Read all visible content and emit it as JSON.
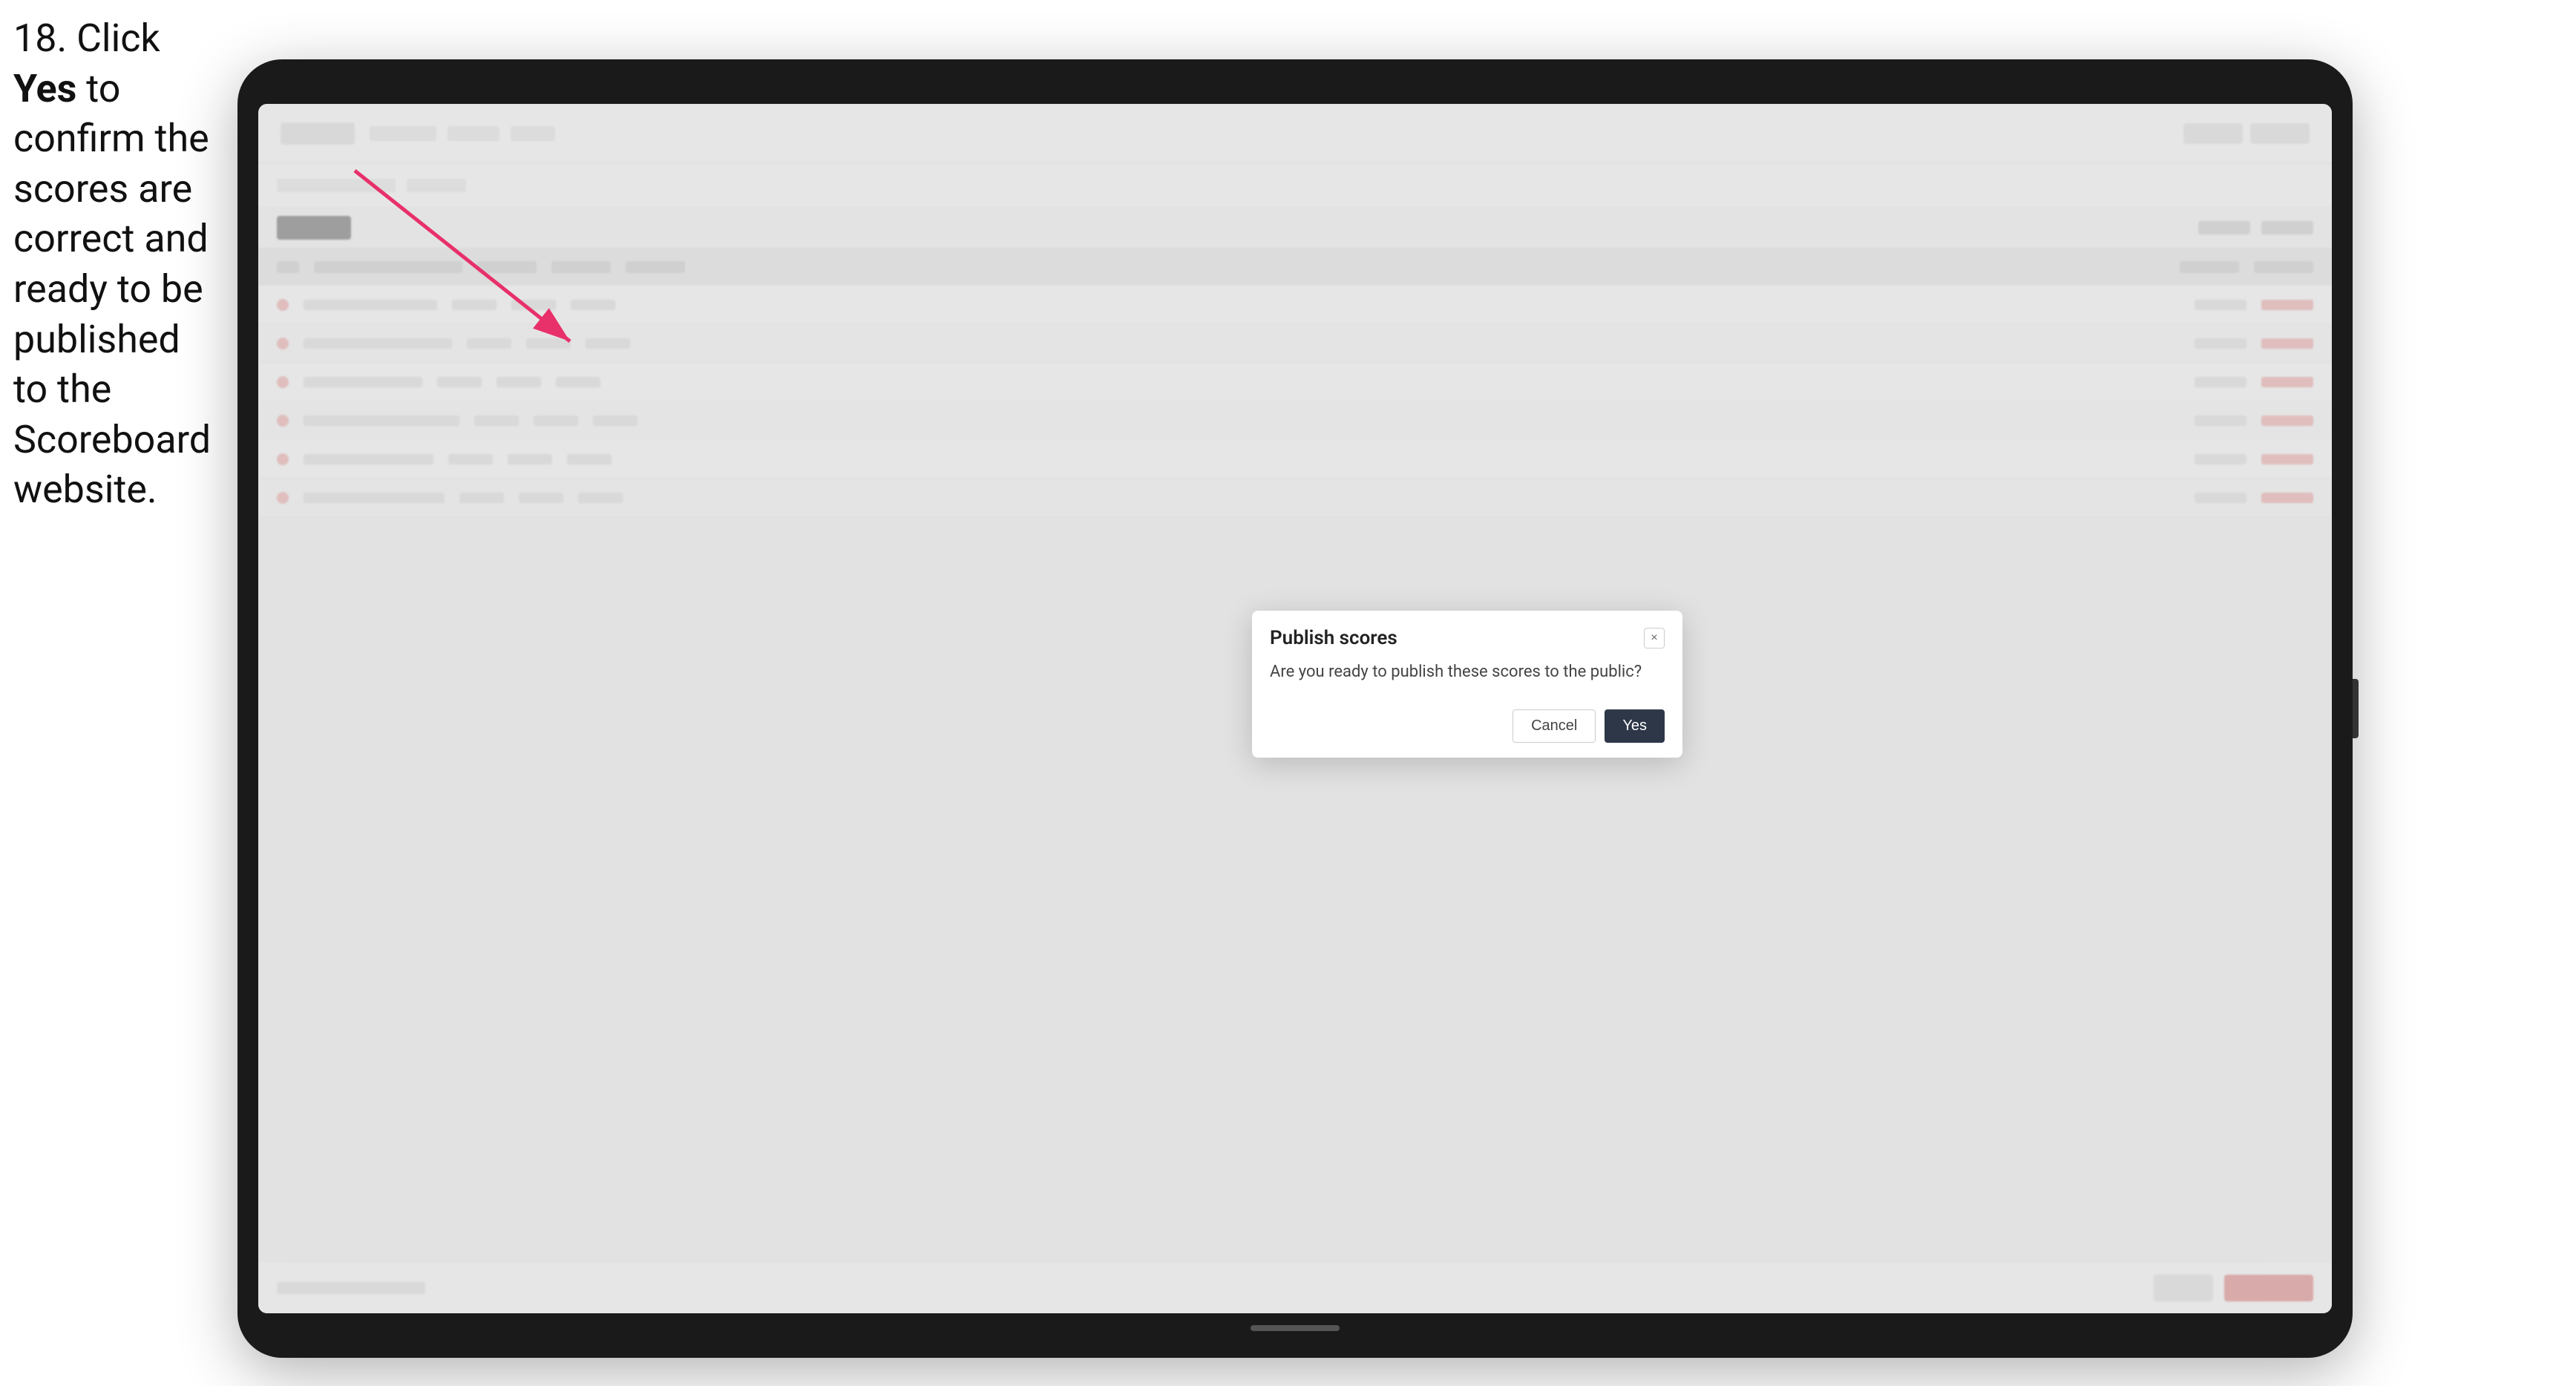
{
  "instruction": {
    "step": "18.",
    "text_before_bold": " Click ",
    "bold_text": "Yes",
    "text_after": " to confirm the scores are correct and ready to be published to the Scoreboard website."
  },
  "dialog": {
    "title": "Publish scores",
    "body_text": "Are you ready to publish these scores to the public?",
    "cancel_label": "Cancel",
    "yes_label": "Yes",
    "close_icon": "×"
  },
  "colors": {
    "yes_button_bg": "#2d3748",
    "cancel_button_border": "#ccc",
    "arrow_color": "#e83060"
  }
}
